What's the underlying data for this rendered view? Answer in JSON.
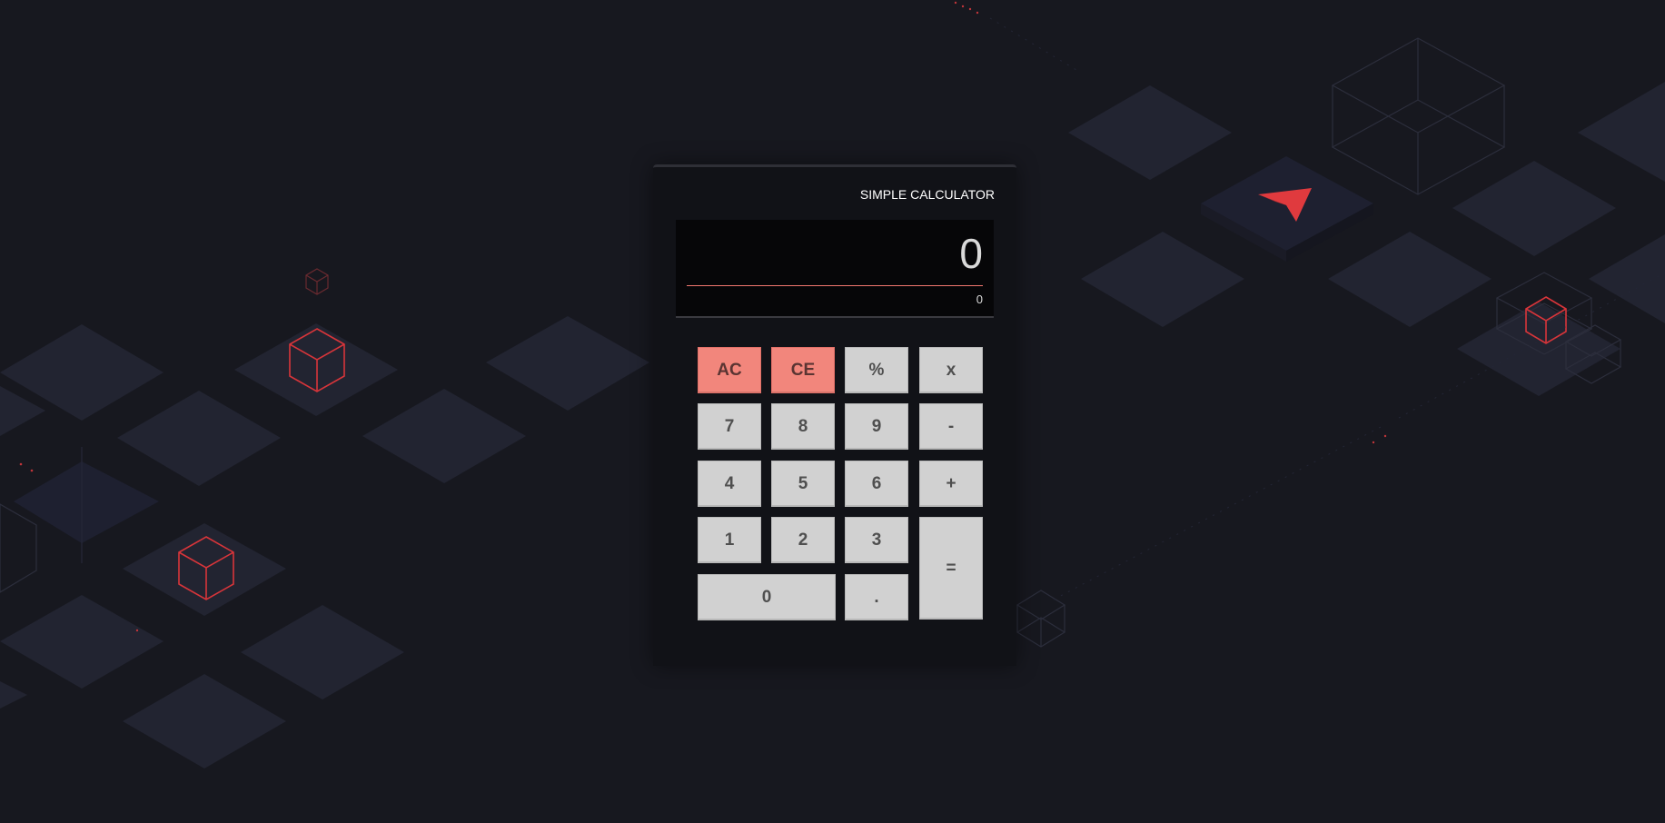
{
  "calculator": {
    "title": "SIMPLE CALCULATOR",
    "display_value": "0",
    "history_value": "0"
  },
  "keys": {
    "ac": "AC",
    "ce": "CE",
    "percent": "%",
    "multiply": "x",
    "seven": "7",
    "eight": "8",
    "nine": "9",
    "minus": "-",
    "four": "4",
    "five": "5",
    "six": "6",
    "plus": "+",
    "one": "1",
    "two": "2",
    "three": "3",
    "equals": "=",
    "zero": "0",
    "decimal": "."
  },
  "colors": {
    "background": "#17181f",
    "tile": "#222432",
    "accent_red": "#e03a3e",
    "clear_key": "#f2867c",
    "number_key": "#d1d1d1"
  },
  "decorations": {
    "logo_icon": "red-arrowhead-logo-icon",
    "cube_icon": "red-wireframe-cube-icon"
  }
}
